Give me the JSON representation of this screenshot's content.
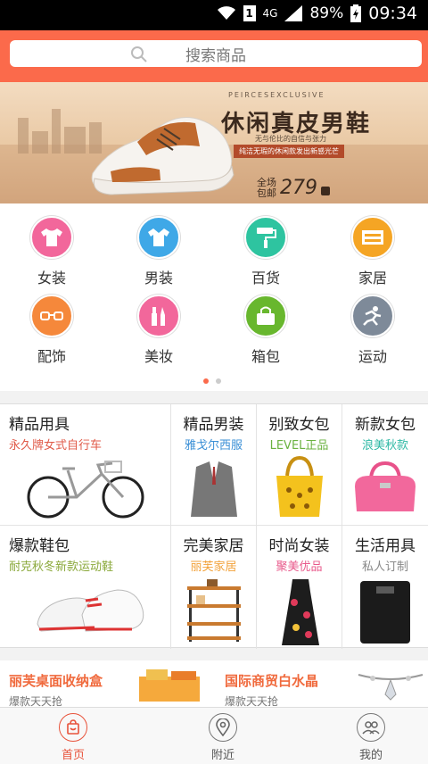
{
  "statusbar": {
    "network": "4G",
    "battery": "89%",
    "time": "09:34"
  },
  "search": {
    "placeholder": "搜索商品"
  },
  "banner": {
    "brand": "PEIRCESEXCLUSIVE",
    "title": "休闲真皮男鞋",
    "subtitle": "无与伦比的自信与张力",
    "tagline": "纯洁无瑕的休闲款发出新感光芒",
    "price_label_1": "全场",
    "price_label_2": "包邮",
    "price": "279"
  },
  "categories": [
    {
      "label": "女装",
      "icon": "tshirt-icon",
      "color": "#f2679b"
    },
    {
      "label": "男装",
      "icon": "shirt-icon",
      "color": "#3fa8e7"
    },
    {
      "label": "百货",
      "icon": "roller-icon",
      "color": "#2ec4a0"
    },
    {
      "label": "家居",
      "icon": "cabinet-icon",
      "color": "#f5a524"
    },
    {
      "label": "配饰",
      "icon": "glasses-icon",
      "color": "#f5883b"
    },
    {
      "label": "美妆",
      "icon": "makeup-icon",
      "color": "#f2679b"
    },
    {
      "label": "箱包",
      "icon": "bag-icon",
      "color": "#68b72e"
    },
    {
      "label": "运动",
      "icon": "running-icon",
      "color": "#7e8a99"
    }
  ],
  "pager": {
    "count": 2,
    "active": 0
  },
  "products": [
    {
      "title": "精品用具",
      "subtitle": "永久牌女式自行车",
      "sub_color": "#e05a48"
    },
    {
      "title": "精品男装",
      "subtitle": "雅戈尔西服",
      "sub_color": "#3a8fd6"
    },
    {
      "title": "别致女包",
      "subtitle": "LEVEL正品",
      "sub_color": "#6ab240"
    },
    {
      "title": "新款女包",
      "subtitle": "浪美秋款",
      "sub_color": "#2fb9a5"
    },
    {
      "title": "爆款鞋包",
      "subtitle": "耐克秋冬新款运动鞋",
      "sub_color": "#8aa83a"
    },
    {
      "title": "完美家居",
      "subtitle": "丽芙家居",
      "sub_color": "#f2a23a"
    },
    {
      "title": "时尚女装",
      "subtitle": "聚美优品",
      "sub_color": "#e8588a"
    },
    {
      "title": "生活用具",
      "subtitle": "私人订制",
      "sub_color": "#888888"
    }
  ],
  "ads": [
    {
      "title": "丽芙桌面收纳盒",
      "subtitle": "爆款天天抢"
    },
    {
      "title": "国际商贸白水晶",
      "subtitle": "爆款天天抢"
    }
  ],
  "tabs": [
    {
      "label": "首页",
      "icon": "home-bag-icon",
      "active": true
    },
    {
      "label": "附近",
      "icon": "location-icon",
      "active": false
    },
    {
      "label": "我的",
      "icon": "user-icon",
      "active": false
    }
  ],
  "colors": {
    "accent": "#fb6a4b",
    "active_tab": "#e8523a"
  }
}
